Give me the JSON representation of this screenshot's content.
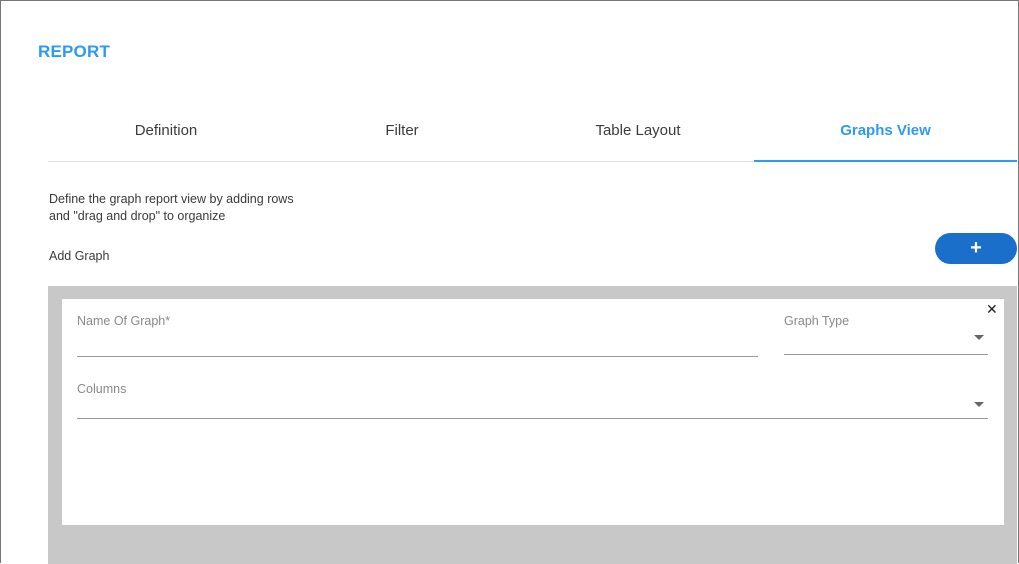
{
  "header": {
    "title": "REPORT"
  },
  "tabs": [
    {
      "label": "Definition",
      "active": false
    },
    {
      "label": "Filter",
      "active": false
    },
    {
      "label": "Table Layout",
      "active": false
    },
    {
      "label": "Graphs View",
      "active": true
    }
  ],
  "graphs_view": {
    "description_line1": "Define the graph report view by adding rows",
    "description_line2": "and \"drag and drop\" to organize",
    "add_graph_label": "Add Graph",
    "add_button_icon": "plus-icon",
    "add_button_glyph": "+"
  },
  "graph_card": {
    "close_icon": "close-icon",
    "close_glyph": "✕",
    "name_placeholder": "Name Of Graph*",
    "name_value": "",
    "graph_type_placeholder": "Graph Type",
    "graph_type_value": "",
    "columns_placeholder": "Columns",
    "columns_value": ""
  },
  "colors": {
    "accent": "#2f9af2",
    "button": "#1a6fcb",
    "panel_bg": "#c8c8c8"
  }
}
